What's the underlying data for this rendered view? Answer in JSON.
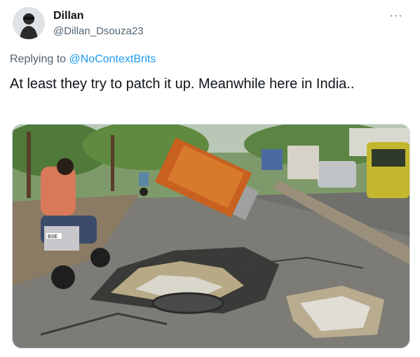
{
  "author": {
    "display_name": "Dillan",
    "handle": "@Dillan_Dsouza23",
    "avatar_icon": "profile-avatar"
  },
  "more_icon": "more-horizontal-icon",
  "more_label": "···",
  "reply": {
    "prefix": "Replying to",
    "target": "@NoContextBrits"
  },
  "tweet": {
    "text": "At least they try to patch it up. Meanwhile here in India.."
  },
  "media": {
    "description_icon": "photo-road-pothole",
    "plate": "BSE"
  },
  "colors": {
    "link": "#1d9bf0",
    "secondary": "#536471",
    "primary": "#0f1419"
  }
}
